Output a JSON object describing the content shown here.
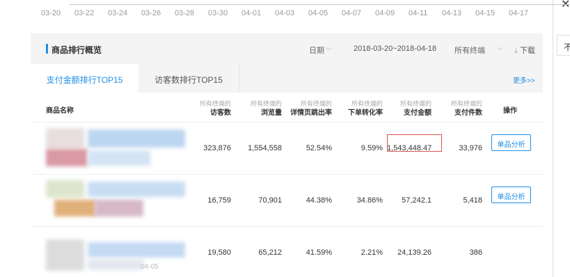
{
  "side": {
    "close_glyph": "✕",
    "input_value": "不"
  },
  "axis": {
    "dates": [
      "03-20",
      "03-22",
      "03-24",
      "03-26",
      "03-28",
      "03-30",
      "04-01",
      "04-03",
      "04-05",
      "04-07",
      "04-09",
      "04-11",
      "04-13",
      "04-15",
      "04-17"
    ]
  },
  "header": {
    "title": "商品排行概览",
    "date_label": "日期",
    "date_range": "2018-03-20~2018-04-18",
    "terminal_select": "所有终端",
    "download_label": "下载",
    "chevron_glyph": "﹀",
    "download_glyph": "⤓"
  },
  "tabs": [
    {
      "label": "支付金额排行TOP15",
      "active": true
    },
    {
      "label": "访客数排行TOP15",
      "active": false
    }
  ],
  "more_link": "更多>>",
  "columns": {
    "name": "商品名称",
    "operation": "操作",
    "metrics": [
      {
        "sub": "所有终端的",
        "main": "访客数"
      },
      {
        "sub": "所有终端的",
        "main": "浏览量"
      },
      {
        "sub": "所有终端的",
        "main": "详情页跳出率"
      },
      {
        "sub": "所有终端的",
        "main": "下单转化率"
      },
      {
        "sub": "所有终端的",
        "main": "支付金额"
      },
      {
        "sub": "所有终端的",
        "main": "支付件数"
      }
    ]
  },
  "rows": [
    {
      "visitors": "323,876",
      "pageviews": "1,554,558",
      "bounce_rate": "52.54%",
      "conversion": "9.59%",
      "payment_amount": "1,543,448.47",
      "payment_items": "33,976",
      "action": "单品分析",
      "has_action": true,
      "highlighted": true
    },
    {
      "visitors": "16,759",
      "pageviews": "70,901",
      "bounce_rate": "44.38%",
      "conversion": "34.86%",
      "payment_amount": "57,242.1",
      "payment_items": "5,418",
      "action": "单品分析",
      "has_action": true,
      "highlighted": false
    },
    {
      "visitors": "19,580",
      "pageviews": "65,212",
      "bounce_rate": "41.59%",
      "conversion": "2.21%",
      "payment_amount": "24,139.26",
      "payment_items": "386",
      "action": "",
      "has_action": false,
      "highlighted": false
    }
  ],
  "row3_leak": "04-05",
  "colors": {
    "accent": "#1e8ee5",
    "highlight_border": "#d9534f",
    "panel_bg": "#f4f4f4"
  }
}
